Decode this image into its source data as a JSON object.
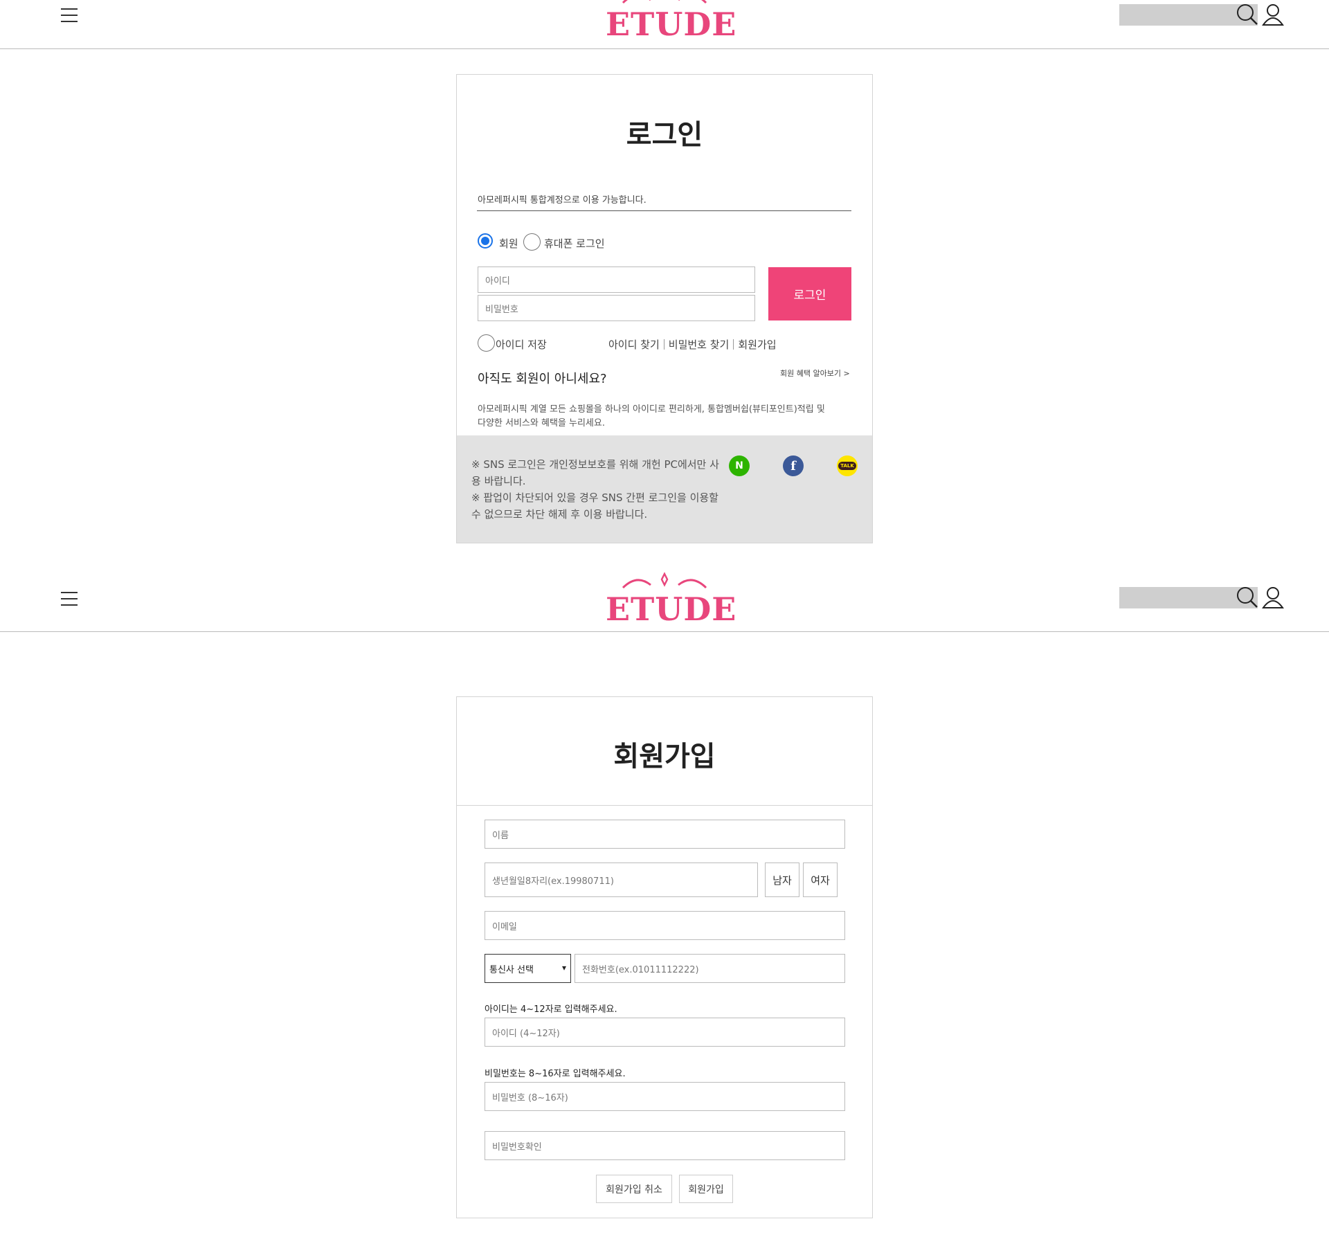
{
  "header": {
    "logo_text": "ETUDE",
    "brand_color": "#e8467c"
  },
  "login": {
    "title": "로그인",
    "notice": "아모레퍼시픽 통합계정으로 이용 가능합니다.",
    "radio_member": "회원",
    "radio_phone": "휴대폰 로그인",
    "selected_radio": "회원",
    "id_placeholder": "아이디",
    "pw_placeholder": "비밀번호",
    "login_button": "로그인",
    "save_id": "아이디 저장",
    "find_id": "아이디 찾기",
    "find_pw": "비밀번호 찾기",
    "join": "회원가입",
    "not_member_heading": "아직도 회원이 아니세요?",
    "benefit_link": "회원 혜택 알아보기 >",
    "desc_line1": "아모레퍼시픽 계열 모든 쇼핑몰을 하나의 아이디로 편리하게, 통합멤버쉽(뷰티포인트)적립 및",
    "desc_line2": "다양한 서비스와 혜택을 누리세요.",
    "sns_line1": "※ SNS 로그인은 개인정보보호를 위해 개헌 PC에서만 사",
    "sns_line2": "용 바랍니다.",
    "sns_line3": "※ 팝업이 차단되어 있을 경우 SNS 간편 로그인을 이용할",
    "sns_line4": "수 없으므로 차단 해제 후 이용 바랍니다.",
    "sns_naver": "N",
    "sns_facebook": "f",
    "sns_kakao": "TALK",
    "accent_color": "#ef4478"
  },
  "signup": {
    "title": "회원가입",
    "name_placeholder": "이름",
    "birth_placeholder": "생년월일8자리(ex.19980711)",
    "male": "남자",
    "female": "여자",
    "email_placeholder": "이메일",
    "carrier_select": "통신사 선택",
    "phone_placeholder": "전화번호(ex.01011112222)",
    "id_note": "아이디는 4~12자로 입력해주세요.",
    "id_placeholder": "아이디 (4~12자)",
    "pw_note": "비밀번호는 8~16자로 입력해주세요.",
    "pw_placeholder": "비밀번호 (8~16자)",
    "pw_confirm_placeholder": "비밀번호확인",
    "cancel_button": "회원가입 취소",
    "submit_button": "회원가입"
  }
}
